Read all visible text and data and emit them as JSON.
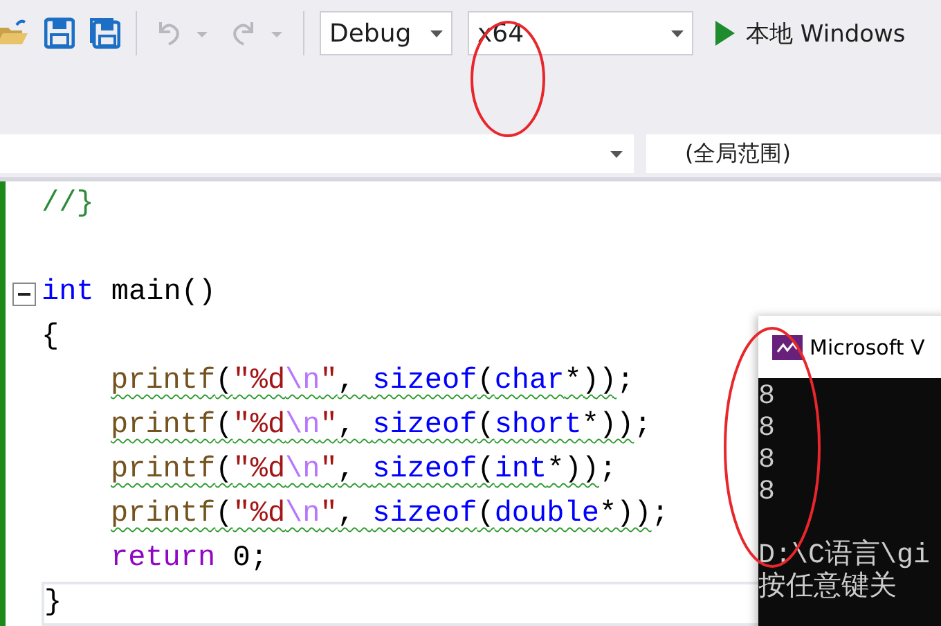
{
  "toolbar": {
    "configuration": "Debug",
    "platform": "x64",
    "run_label": "本地 Windows"
  },
  "scope_bar": {
    "right": "(全局范围)"
  },
  "editor": {
    "lines": [
      {
        "tokens": [
          {
            "text": "//}",
            "kind": "comment"
          }
        ],
        "indented": false,
        "foldable": false,
        "warning": false,
        "current": false
      },
      {
        "foldable": false,
        "current": false
      },
      {
        "tokens": [
          {
            "text": "int",
            "kind": "keyword"
          },
          {
            "text": " main()",
            "kind": "plain"
          }
        ],
        "indented": false,
        "foldable": true,
        "warning": false,
        "current": false
      },
      {
        "tokens": [
          {
            "text": "{",
            "kind": "plain"
          }
        ],
        "indented": false,
        "foldable": false,
        "warning": false,
        "current": false
      },
      {
        "tokens": [
          {
            "text": "printf",
            "kind": "function"
          },
          {
            "text": "(",
            "kind": "plain"
          },
          {
            "text": "\"%d",
            "kind": "string"
          },
          {
            "text": "\\n",
            "kind": "escape"
          },
          {
            "text": "\"",
            "kind": "string"
          },
          {
            "text": ", ",
            "kind": "plain"
          },
          {
            "text": "sizeof",
            "kind": "keyword"
          },
          {
            "text": "(",
            "kind": "plain"
          },
          {
            "text": "char",
            "kind": "keyword"
          },
          {
            "text": "*))",
            "kind": "plain"
          },
          {
            "text": ";",
            "kind": "plain"
          }
        ],
        "indented": true,
        "foldable": false,
        "warning": true,
        "current": false
      },
      {
        "tokens": [
          {
            "text": "printf",
            "kind": "function"
          },
          {
            "text": "(",
            "kind": "plain"
          },
          {
            "text": "\"%d",
            "kind": "string"
          },
          {
            "text": "\\n",
            "kind": "escape"
          },
          {
            "text": "\"",
            "kind": "string"
          },
          {
            "text": ", ",
            "kind": "plain"
          },
          {
            "text": "sizeof",
            "kind": "keyword"
          },
          {
            "text": "(",
            "kind": "plain"
          },
          {
            "text": "short",
            "kind": "keyword"
          },
          {
            "text": "*))",
            "kind": "plain"
          },
          {
            "text": ";",
            "kind": "plain"
          }
        ],
        "indented": true,
        "foldable": false,
        "warning": true,
        "current": false
      },
      {
        "tokens": [
          {
            "text": "printf",
            "kind": "function"
          },
          {
            "text": "(",
            "kind": "plain"
          },
          {
            "text": "\"%d",
            "kind": "string"
          },
          {
            "text": "\\n",
            "kind": "escape"
          },
          {
            "text": "\"",
            "kind": "string"
          },
          {
            "text": ", ",
            "kind": "plain"
          },
          {
            "text": "sizeof",
            "kind": "keyword"
          },
          {
            "text": "(",
            "kind": "plain"
          },
          {
            "text": "int",
            "kind": "keyword"
          },
          {
            "text": "*))",
            "kind": "plain"
          },
          {
            "text": ";",
            "kind": "plain"
          }
        ],
        "indented": true,
        "foldable": false,
        "warning": true,
        "current": false
      },
      {
        "tokens": [
          {
            "text": "printf",
            "kind": "function"
          },
          {
            "text": "(",
            "kind": "plain"
          },
          {
            "text": "\"%d",
            "kind": "string"
          },
          {
            "text": "\\n",
            "kind": "escape"
          },
          {
            "text": "\"",
            "kind": "string"
          },
          {
            "text": ", ",
            "kind": "plain"
          },
          {
            "text": "sizeof",
            "kind": "keyword"
          },
          {
            "text": "(",
            "kind": "plain"
          },
          {
            "text": "double",
            "kind": "keyword"
          },
          {
            "text": "*))",
            "kind": "plain"
          },
          {
            "text": ";",
            "kind": "plain"
          }
        ],
        "indented": true,
        "foldable": false,
        "warning": true,
        "current": false
      },
      {
        "tokens": [
          {
            "text": "return",
            "kind": "control"
          },
          {
            "text": " 0;",
            "kind": "plain"
          }
        ],
        "indented": true,
        "foldable": false,
        "warning": false,
        "current": false
      },
      {
        "tokens": [
          {
            "text": "}",
            "kind": "plain"
          }
        ],
        "indented": false,
        "foldable": false,
        "warning": false,
        "current": true
      }
    ]
  },
  "console": {
    "title": "Microsoft V",
    "output": [
      "8",
      "8",
      "8",
      "8"
    ],
    "prompt": [
      "D:\\C语言\\gi",
      "按任意键关"
    ]
  }
}
